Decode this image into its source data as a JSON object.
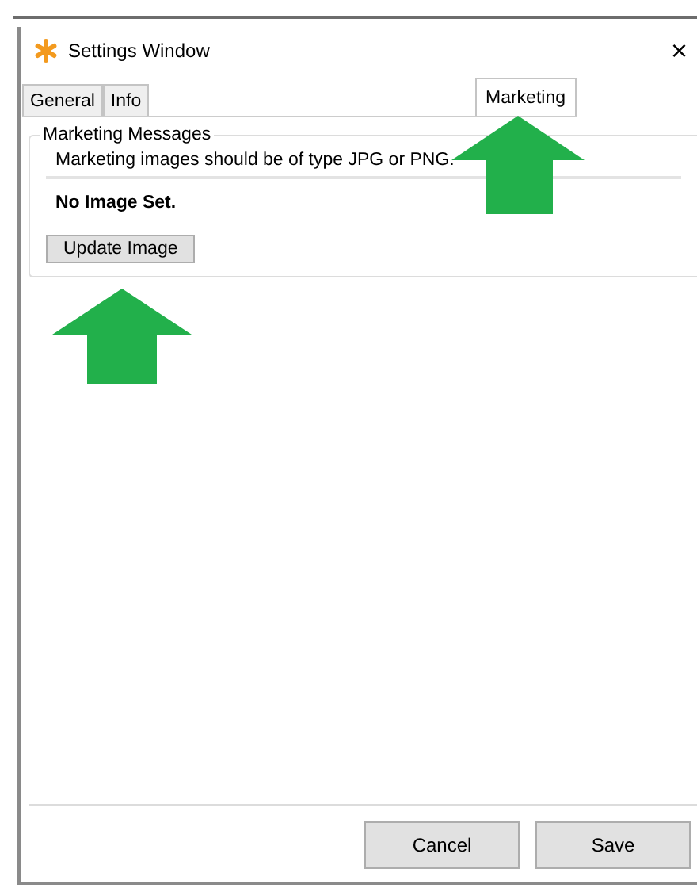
{
  "window": {
    "title": "Settings Window",
    "close": "×"
  },
  "tabs": [
    {
      "label": "General",
      "selected": false
    },
    {
      "label": "Info",
      "selected": false
    },
    {
      "label": "Marketing",
      "selected": true
    }
  ],
  "group": {
    "title": "Marketing Messages",
    "message": "Marketing images should be of type JPG or PNG.",
    "status": "No Image Set.",
    "button": "Update Image"
  },
  "buttons": [
    "Cancel",
    "Save"
  ]
}
